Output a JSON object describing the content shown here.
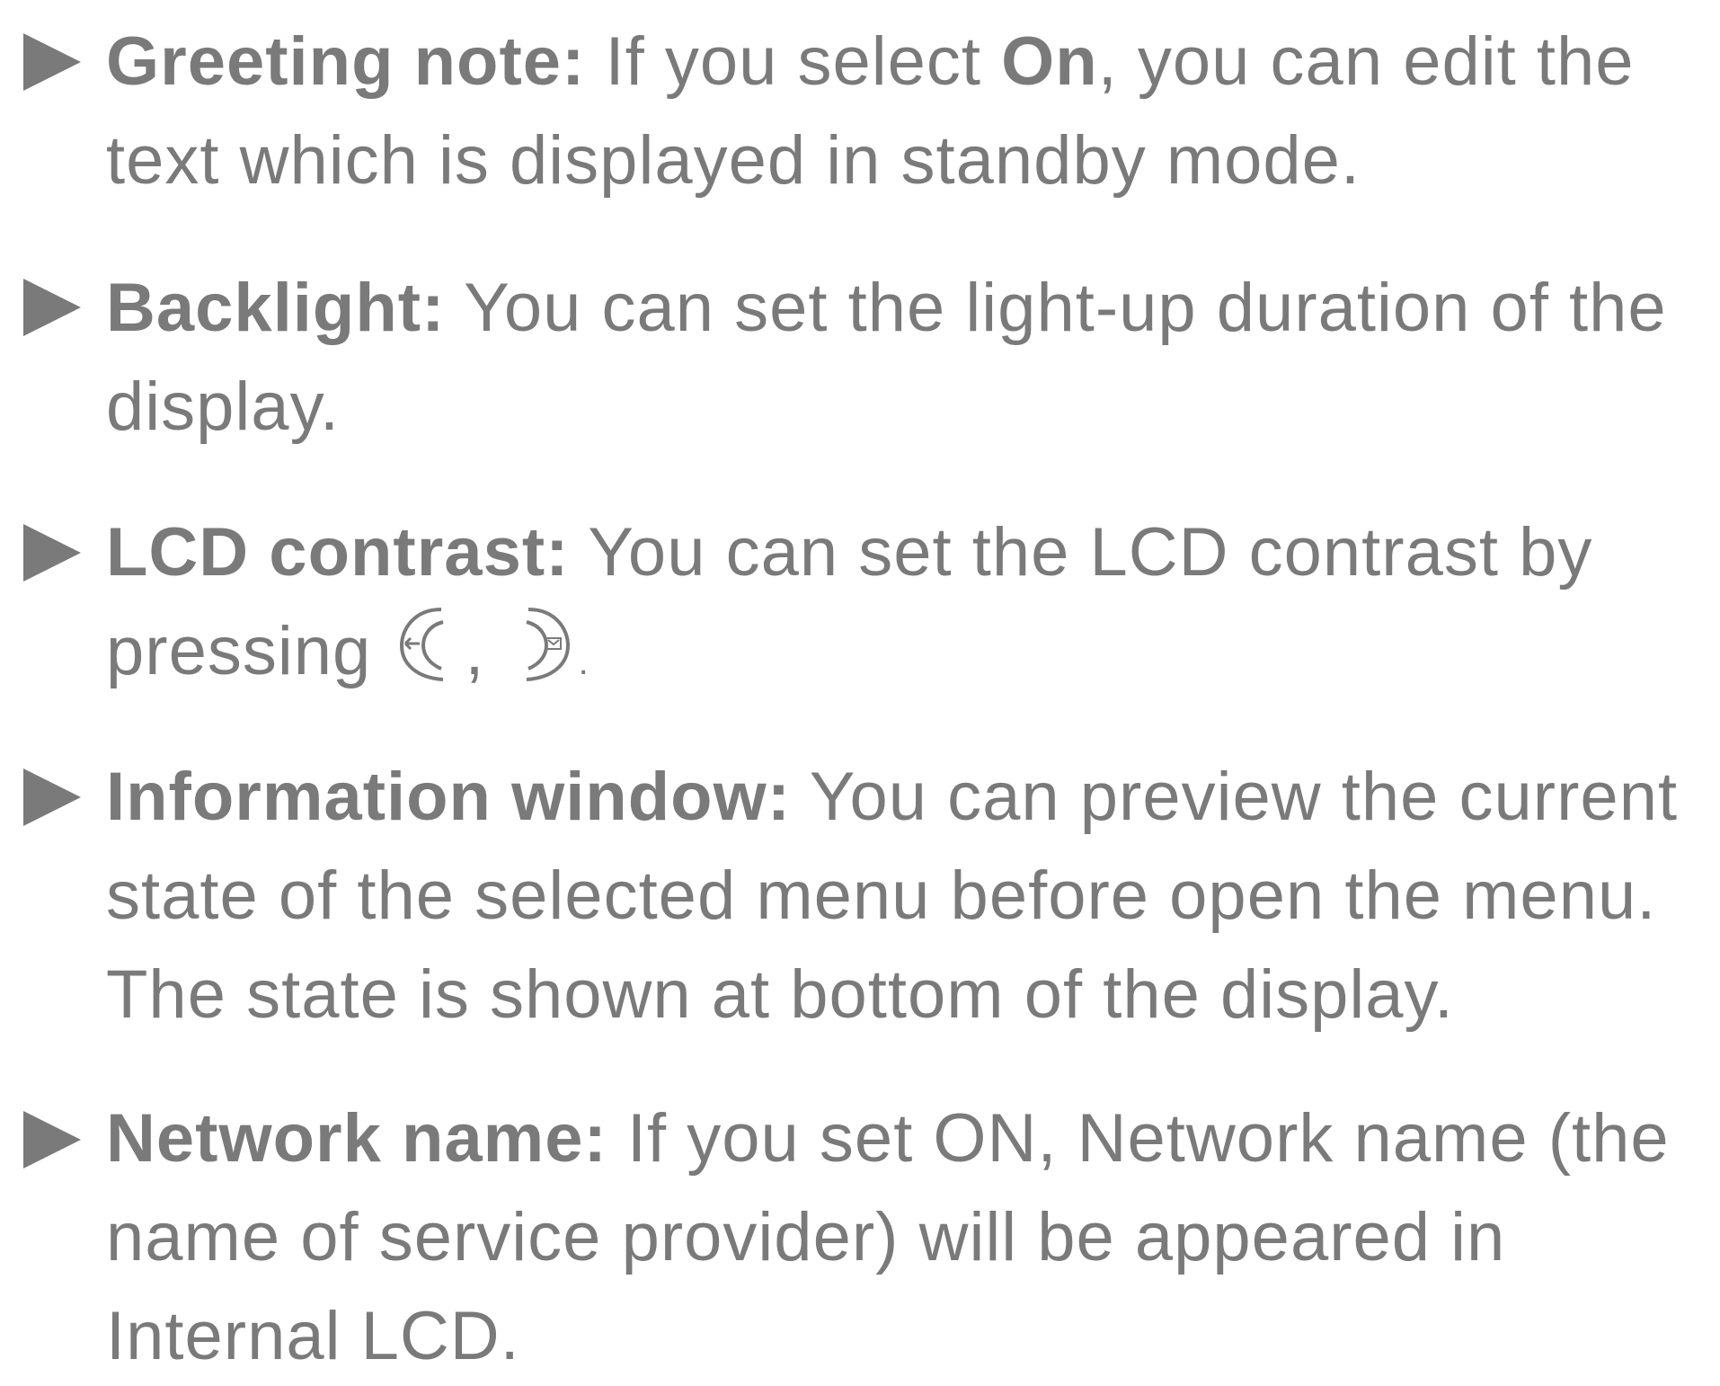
{
  "items": [
    {
      "term": "Greeting note:",
      "pre": " If you select ",
      "keyword": "On",
      "post": ", you can edit the",
      "line2": "text which is displayed in standby mode."
    },
    {
      "term": "Backlight:",
      "line1_rest": " You can set the light-up duration of the",
      "line2": "display."
    },
    {
      "term": "LCD contrast:",
      "line1_rest": " You can set the LCD contrast by",
      "line2_pre": "pressing",
      "icon_left": "left-nav-key-icon",
      "separator": ",",
      "icon_right": "right-nav-key-icon",
      "line2_end": "."
    },
    {
      "term": "Information window:",
      "line1_rest": " You can preview the current",
      "line2": "state of the selected menu before open the menu.",
      "line3": "The state is shown at bottom of the display."
    },
    {
      "term": "Network name:",
      "line1_rest": " If you set ON, Network name (the",
      "line2": "name of service provider) will be appeared in",
      "line3": "Internal LCD."
    }
  ],
  "colors": {
    "text": "#7a7a7a",
    "background": "#ffffff"
  }
}
